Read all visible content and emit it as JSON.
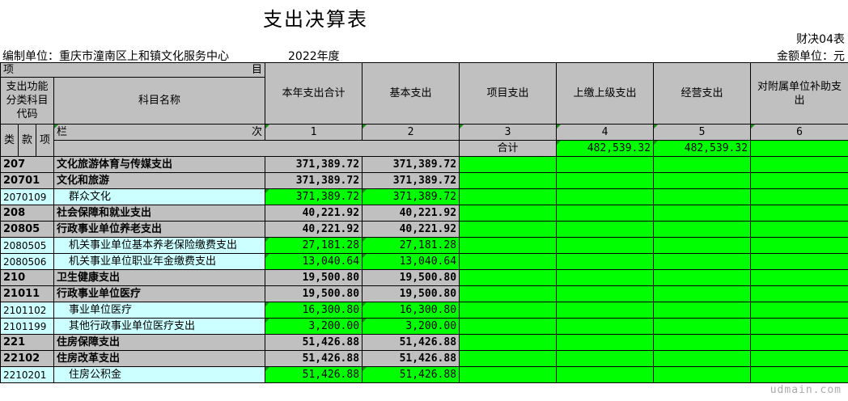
{
  "doc": {
    "title": "支出决算表",
    "form_no": "财决04表",
    "unit_label": "编制单位：重庆市潼南区上和镇文化服务中心",
    "year": "2022年度",
    "money_unit": "金额单位：元",
    "watermark": "udmain.com"
  },
  "header": {
    "xiang": "项",
    "mu": "目",
    "func_code": "支出功能分类科目代码",
    "subject_name": "科目名称",
    "lei": "类",
    "kuan": "款",
    "xiang2": "项",
    "lan": "栏",
    "ci": "次",
    "cols": [
      "本年支出合计",
      "基本支出",
      "项目支出",
      "上缴上级支出",
      "经营支出",
      "对附属单位补助支出"
    ],
    "col_nums": [
      "1",
      "2",
      "3",
      "4",
      "5",
      "6"
    ]
  },
  "total": {
    "label": "合计",
    "c1": "482,539.32",
    "c2": "482,539.32"
  },
  "rows": [
    {
      "code": "207",
      "name": "文化旅游体育与传媒支出",
      "c1": "371,389.72",
      "c2": "371,389.72",
      "level": "bold"
    },
    {
      "code": "20701",
      "name": "文化和旅游",
      "c1": "371,389.72",
      "c2": "371,389.72",
      "level": "bold"
    },
    {
      "code": "2070109",
      "name": "群众文化",
      "c1": "371,389.72",
      "c2": "371,389.72",
      "level": "leaf"
    },
    {
      "code": "208",
      "name": "社会保障和就业支出",
      "c1": "40,221.92",
      "c2": "40,221.92",
      "level": "bold"
    },
    {
      "code": "20805",
      "name": "行政事业单位养老支出",
      "c1": "40,221.92",
      "c2": "40,221.92",
      "level": "bold"
    },
    {
      "code": "2080505",
      "name": "机关事业单位基本养老保险缴费支出",
      "c1": "27,181.28",
      "c2": "27,181.28",
      "level": "leaf"
    },
    {
      "code": "2080506",
      "name": "机关事业单位职业年金缴费支出",
      "c1": "13,040.64",
      "c2": "13,040.64",
      "level": "leaf"
    },
    {
      "code": "210",
      "name": "卫生健康支出",
      "c1": "19,500.80",
      "c2": "19,500.80",
      "level": "bold"
    },
    {
      "code": "21011",
      "name": "行政事业单位医疗",
      "c1": "19,500.80",
      "c2": "19,500.80",
      "level": "bold"
    },
    {
      "code": "2101102",
      "name": "事业单位医疗",
      "c1": "16,300.80",
      "c2": "16,300.80",
      "level": "leaf"
    },
    {
      "code": "2101199",
      "name": "其他行政事业单位医疗支出",
      "c1": "3,200.00",
      "c2": "3,200.00",
      "level": "leaf"
    },
    {
      "code": "221",
      "name": "住房保障支出",
      "c1": "51,426.88",
      "c2": "51,426.88",
      "level": "bold"
    },
    {
      "code": "22102",
      "name": "住房改革支出",
      "c1": "51,426.88",
      "c2": "51,426.88",
      "level": "bold"
    },
    {
      "code": "2210201",
      "name": "住房公积金",
      "c1": "51,426.88",
      "c2": "51,426.88",
      "level": "leaf"
    }
  ],
  "colors": {
    "header_gray": "#c0c0c0",
    "value_green": "#00ff00",
    "leaf_cyan": "#ccffff"
  }
}
